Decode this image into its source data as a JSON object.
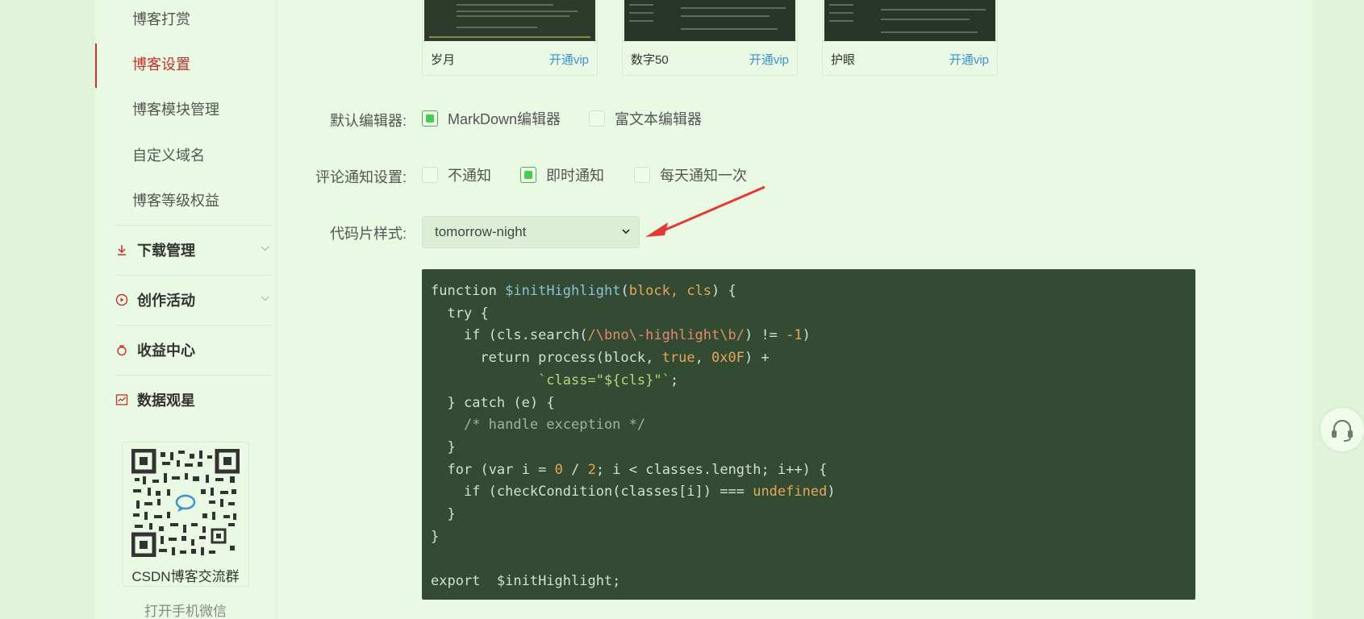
{
  "sidebar": {
    "items": [
      {
        "label": "博客打赏",
        "active": false
      },
      {
        "label": "博客设置",
        "active": true
      },
      {
        "label": "博客模块管理",
        "active": false
      },
      {
        "label": "自定义域名",
        "active": false
      },
      {
        "label": "博客等级权益",
        "active": false
      }
    ],
    "groups": [
      {
        "label": "下载管理",
        "icon": "download-icon",
        "has_chevron": true
      },
      {
        "label": "创作活动",
        "icon": "play-circle-icon",
        "has_chevron": true
      },
      {
        "label": "收益中心",
        "icon": "money-bag-icon",
        "has_chevron": false
      },
      {
        "label": "数据观星",
        "icon": "chart-icon",
        "has_chevron": false
      }
    ],
    "qr": {
      "label": "CSDN博客交流群",
      "hint": "打开手机微信"
    }
  },
  "themes": [
    {
      "name": "岁月",
      "vip": "开通vip"
    },
    {
      "name": "数字50",
      "vip": "开通vip"
    },
    {
      "name": "护眼",
      "vip": "开通vip"
    }
  ],
  "editor": {
    "label": "默认编辑器:",
    "options": [
      {
        "label": "MarkDown编辑器",
        "checked": true
      },
      {
        "label": "富文本编辑器",
        "checked": false
      }
    ]
  },
  "notify": {
    "label": "评论通知设置:",
    "options": [
      {
        "label": "不通知",
        "checked": false
      },
      {
        "label": "即时通知",
        "checked": true
      },
      {
        "label": "每天通知一次",
        "checked": false
      }
    ]
  },
  "code_style": {
    "label": "代码片样式:",
    "selected": "tomorrow-night"
  },
  "colors": {
    "accent": "#c8312b",
    "code_bg": "#344b33",
    "page_bg": "#e9f9e3",
    "check": "#4cc950",
    "link": "#3c93d2"
  }
}
